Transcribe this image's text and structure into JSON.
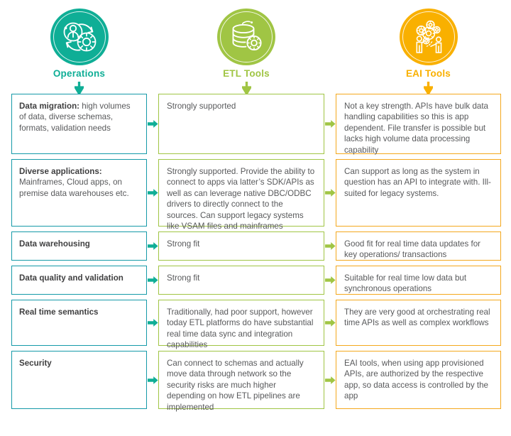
{
  "columns": [
    {
      "id": "operations",
      "label": "Operations",
      "color": "#0fae96",
      "border_color": "#159aa8",
      "icon": "operations-people-gear-cycle-icon",
      "arrow_color": "#0fae96"
    },
    {
      "id": "etl-tools",
      "label": "ETL Tools",
      "color": "#a0c544",
      "border_color": "#a0c544",
      "icon": "etl-database-gear-icon",
      "arrow_color": "#a0c544"
    },
    {
      "id": "eai-tools",
      "label": "EAI Tools",
      "color": "#f9b000",
      "border_color": "#f4a81d",
      "icon": "eai-people-gears-icon",
      "arrow_color": "#f9b000"
    }
  ],
  "connector_colors": {
    "to_etl": "#0fae96",
    "to_eai": "#a0c544"
  },
  "rows": [
    {
      "id": "data-migration",
      "operations_lead": "Data migration:",
      "operations_text": " high volumes of data, diverse schemas, formats, validation needs",
      "etl_text": "Strongly supported",
      "eai_text": "Not a key strength. APIs have bulk data handling capabilities so this is app dependent. File transfer is possible but lacks high volume data processing capability"
    },
    {
      "id": "diverse-applications",
      "operations_lead": "Diverse applications:",
      "operations_text": " Mainframes, Cloud apps, on premise data warehouses etc.",
      "etl_text": "Strongly supported. Provide the ability to connect to apps via latter’s SDK/APIs as well as can leverage native DBC/ODBC drivers to directly connect to the sources. Can support legacy systems like VSAM files and mainframes",
      "eai_text": "Can support as long as the system in question has an API to integrate with. Ill-suited for legacy systems."
    },
    {
      "id": "data-warehousing",
      "operations_lead": "Data warehousing",
      "operations_text": "",
      "etl_text": "Strong fit",
      "eai_text": "Good fit for real time data updates for key operations/ transactions"
    },
    {
      "id": "data-quality-and-validation",
      "operations_lead": "Data quality and validation",
      "operations_text": "",
      "etl_text": "Strong fit",
      "eai_text": "Suitable for real time low data but synchronous operations"
    },
    {
      "id": "real-time-semantics",
      "operations_lead": "Real time semantics",
      "operations_text": "",
      "etl_text": "Traditionally, had poor support, however today ETL platforms do have substantial real time data sync and integration capabilities",
      "eai_text": "They are very good at orchestrating real time APIs as well as complex workflows"
    },
    {
      "id": "security",
      "operations_lead": "Security",
      "operations_text": "",
      "etl_text": "Can connect to schemas and actually move data through network so the security risks are much higher depending on how ETL pipelines are implemented",
      "eai_text": "EAI tools, when using app provisioned APIs, are authorized by the respective app, so data access is controlled by the app"
    }
  ]
}
